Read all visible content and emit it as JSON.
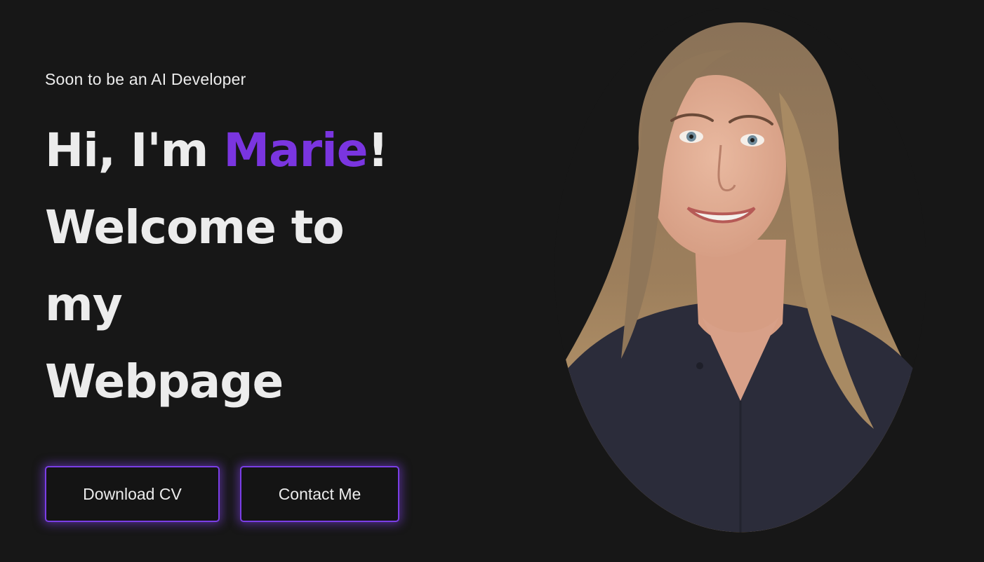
{
  "hero": {
    "tagline": "Soon to be an AI Developer",
    "greeting_prefix": "Hi, I'm ",
    "name": "Marie",
    "greeting_suffix": "!",
    "line2": "Welcome to",
    "line3": "my",
    "line4": "Webpage"
  },
  "buttons": {
    "download_cv": "Download CV",
    "contact_me": "Contact Me"
  },
  "colors": {
    "background": "#171717",
    "text": "#ececec",
    "accent": "#7a35e0",
    "button_border": "#7b3ee6"
  },
  "portrait": {
    "icon": "profile-photo"
  }
}
